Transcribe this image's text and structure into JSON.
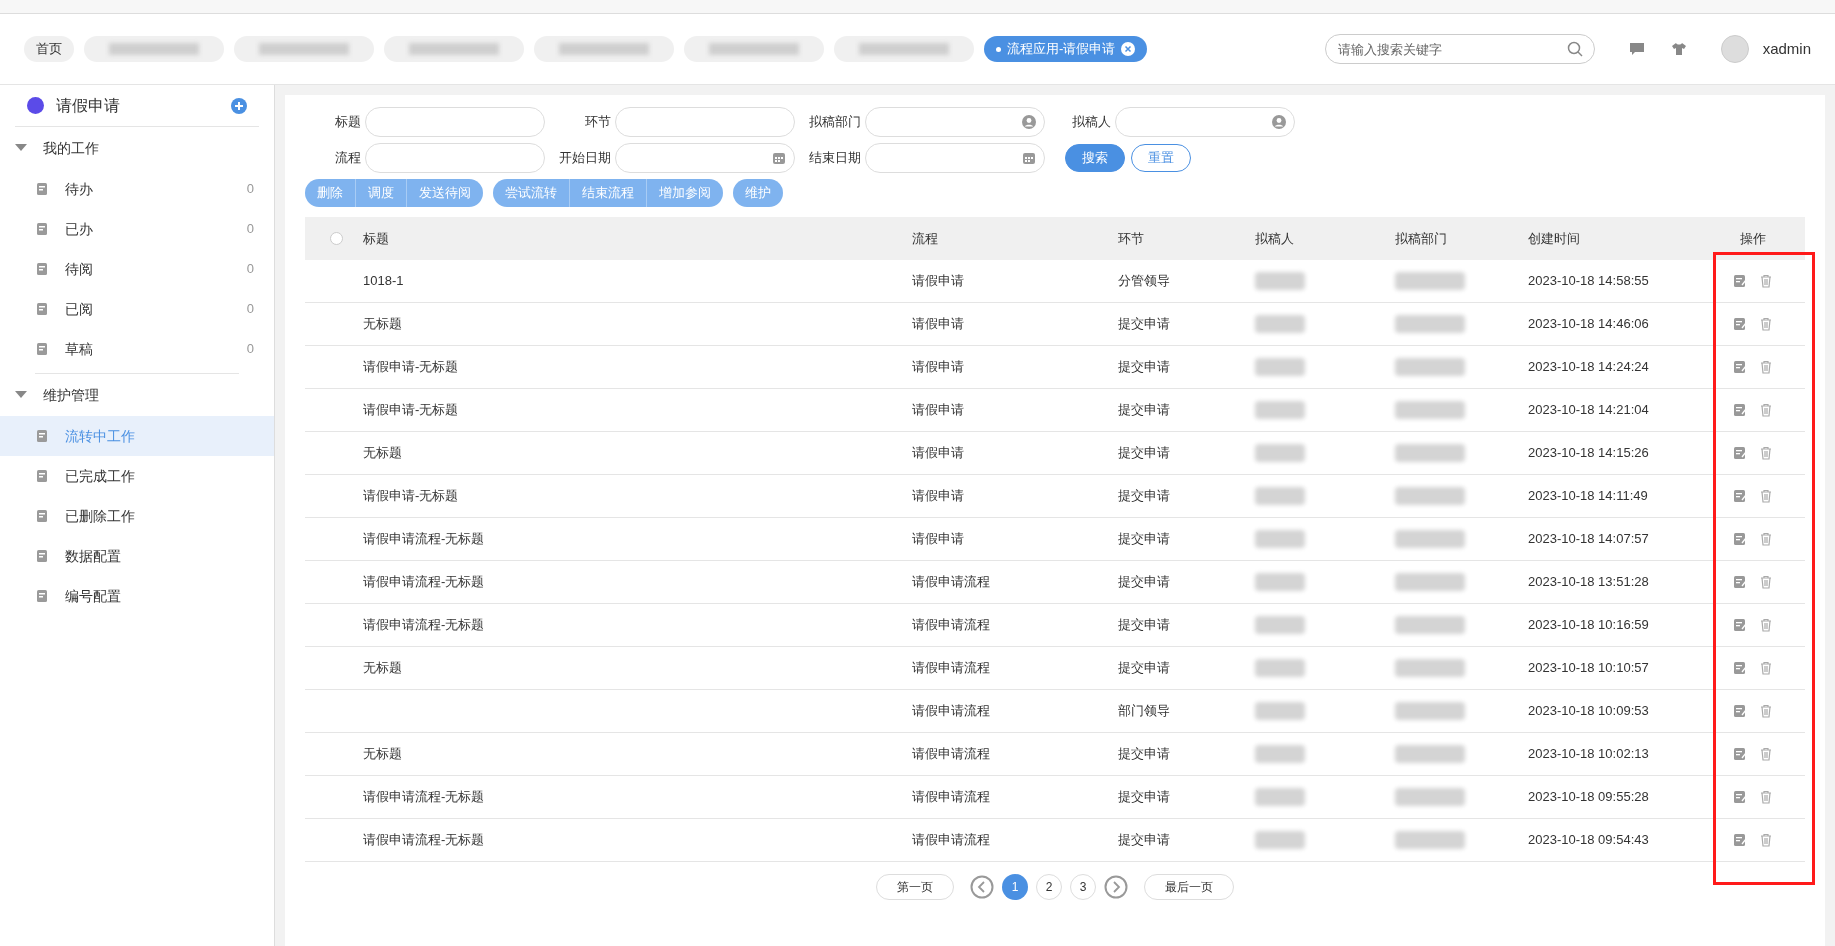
{
  "header": {
    "tabs": [
      {
        "label": "首页",
        "selected": false
      },
      {
        "label": "流程应用-请假申请",
        "selected": true
      }
    ],
    "search": {
      "placeholder": "请输入搜索关键字"
    },
    "user": "xadmin"
  },
  "sidebar": {
    "title": "请假申请",
    "groups": [
      {
        "label": "我的工作",
        "expanded": true,
        "items": [
          {
            "label": "待办",
            "count": "0",
            "selected": false
          },
          {
            "label": "已办",
            "count": "0",
            "selected": false
          },
          {
            "label": "待阅",
            "count": "0",
            "selected": false
          },
          {
            "label": "已阅",
            "count": "0",
            "selected": false
          },
          {
            "label": "草稿",
            "count": "0",
            "selected": false
          }
        ]
      },
      {
        "label": "维护管理",
        "expanded": true,
        "items": [
          {
            "label": "流转中工作",
            "selected": true
          },
          {
            "label": "已完成工作",
            "selected": false
          },
          {
            "label": "已删除工作",
            "selected": false
          },
          {
            "label": "数据配置",
            "selected": false
          },
          {
            "label": "编号配置",
            "selected": false
          }
        ]
      }
    ]
  },
  "filters": [
    {
      "label": "标题",
      "kind": "text"
    },
    {
      "label": "环节",
      "kind": "text"
    },
    {
      "label": "拟稿部门",
      "kind": "person"
    },
    {
      "label": "拟稿人",
      "kind": "person"
    },
    {
      "label": "流程",
      "kind": "text"
    },
    {
      "label": "开始日期",
      "kind": "date"
    },
    {
      "label": "结束日期",
      "kind": "date"
    }
  ],
  "filter_buttons": [
    {
      "label": "搜索",
      "primary": true
    },
    {
      "label": "重置",
      "primary": false
    }
  ],
  "action_groups": [
    [
      "删除",
      "调度",
      "发送待阅"
    ],
    [
      "尝试流转",
      "结束流程",
      "增加参阅"
    ],
    [
      "维护"
    ]
  ],
  "table": {
    "select_all": {
      "checked": false
    },
    "columns": [
      "标题",
      "流程",
      "环节",
      "拟稿人",
      "拟稿部门",
      "创建时间",
      "操作"
    ],
    "rows": [
      {
        "title": "1018-1",
        "flow": "请假申请",
        "step": "分管领导",
        "created": "2023-10-18 14:58:55"
      },
      {
        "title": "无标题",
        "flow": "请假申请",
        "step": "提交申请",
        "created": "2023-10-18 14:46:06"
      },
      {
        "title": "请假申请-无标题",
        "flow": "请假申请",
        "step": "提交申请",
        "created": "2023-10-18 14:24:24"
      },
      {
        "title": "请假申请-无标题",
        "flow": "请假申请",
        "step": "提交申请",
        "created": "2023-10-18 14:21:04"
      },
      {
        "title": "无标题",
        "flow": "请假申请",
        "step": "提交申请",
        "created": "2023-10-18 14:15:26"
      },
      {
        "title": "请假申请-无标题",
        "flow": "请假申请",
        "step": "提交申请",
        "created": "2023-10-18 14:11:49"
      },
      {
        "title": "请假申请流程-无标题",
        "flow": "请假申请",
        "step": "提交申请",
        "created": "2023-10-18 14:07:57"
      },
      {
        "title": "请假申请流程-无标题",
        "flow": "请假申请流程",
        "step": "提交申请",
        "created": "2023-10-18 13:51:28"
      },
      {
        "title": "请假申请流程-无标题",
        "flow": "请假申请流程",
        "step": "提交申请",
        "created": "2023-10-18 10:16:59"
      },
      {
        "title": "无标题",
        "flow": "请假申请流程",
        "step": "提交申请",
        "created": "2023-10-18 10:10:57"
      },
      {
        "flow": "请假申请流程",
        "step": "部门领导",
        "created": "2023-10-18 10:09:53"
      },
      {
        "title": "无标题",
        "flow": "请假申请流程",
        "step": "提交申请",
        "created": "2023-10-18 10:02:13"
      },
      {
        "title": "请假申请流程-无标题",
        "flow": "请假申请流程",
        "step": "提交申请",
        "created": "2023-10-18 09:55:28"
      },
      {
        "title": "请假申请流程-无标题",
        "flow": "请假申请流程",
        "step": "提交申请",
        "created": "2023-10-18 09:54:43"
      }
    ]
  },
  "pagination": {
    "first": "第一页",
    "last": "最后一页",
    "pages": [
      {
        "label": "1",
        "selected": true
      },
      {
        "label": "2",
        "selected": false
      },
      {
        "label": "3",
        "selected": false
      }
    ]
  }
}
